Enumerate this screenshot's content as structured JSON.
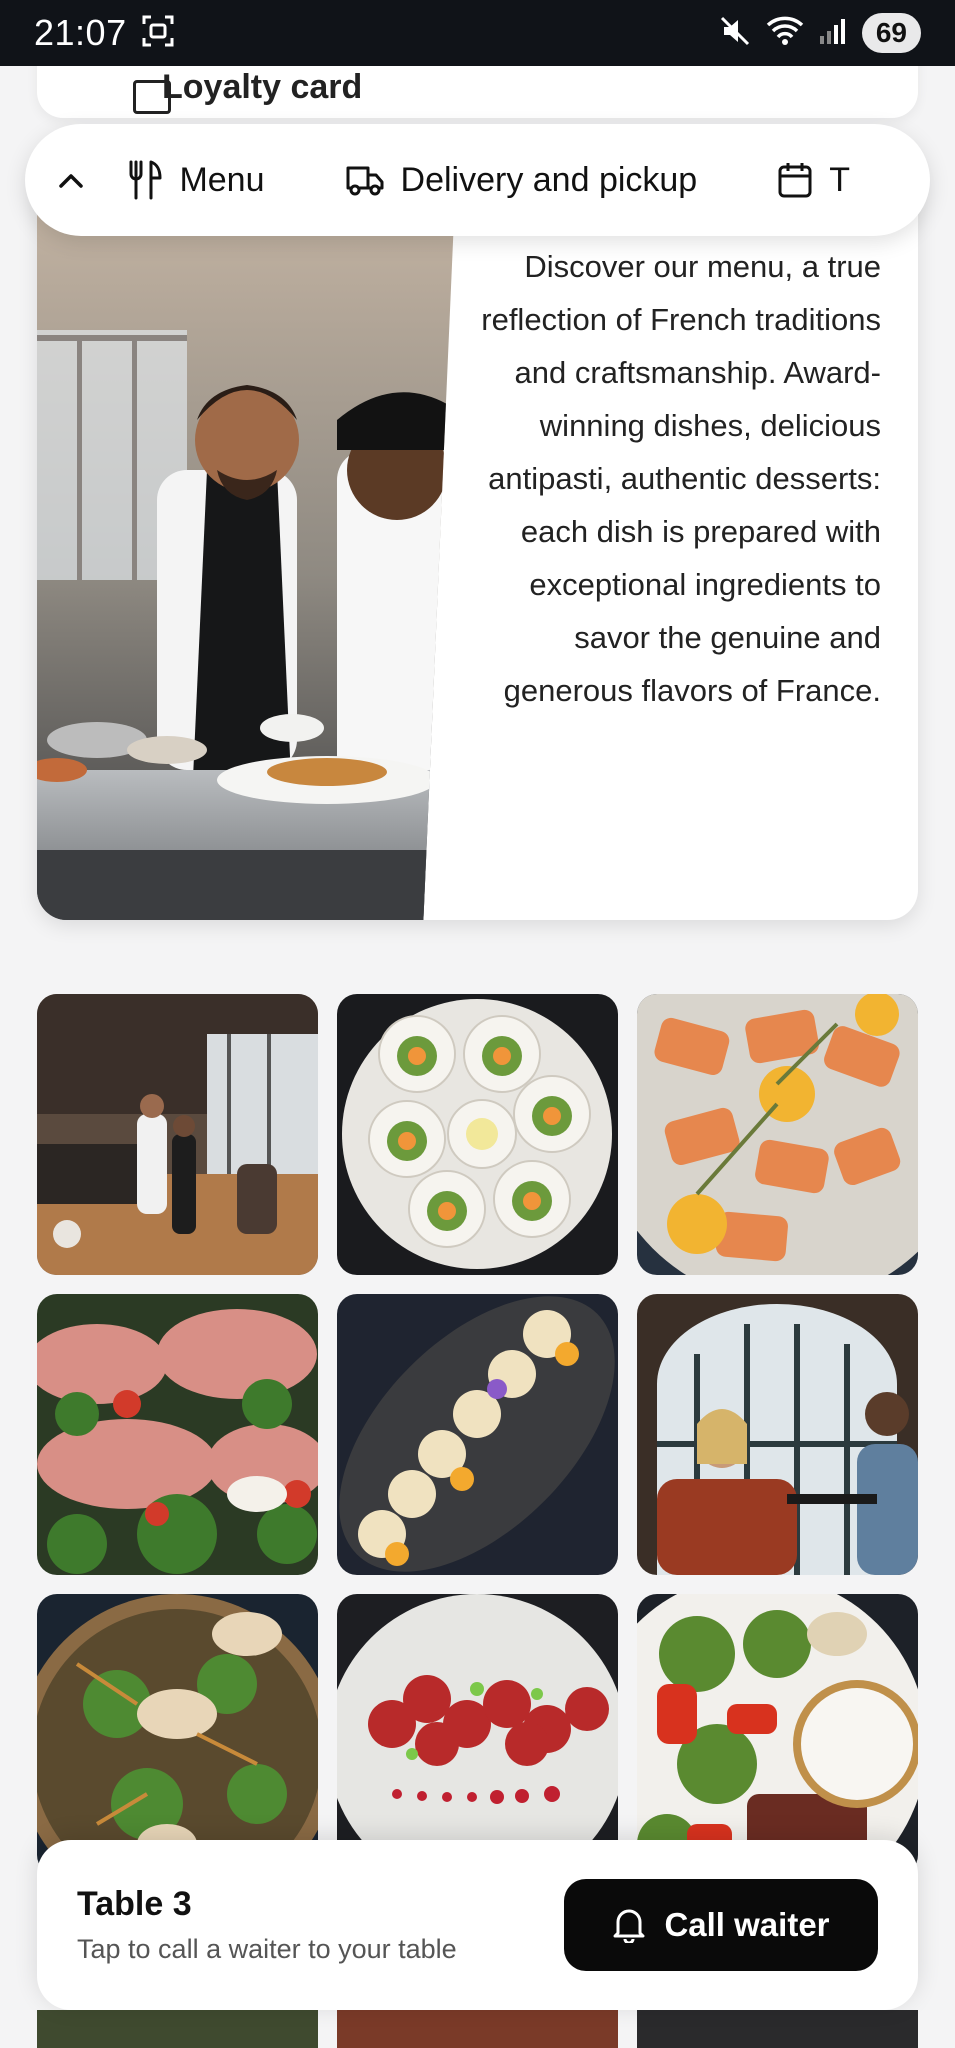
{
  "status_bar": {
    "time": "21:07",
    "battery": "69"
  },
  "loyalty_card": {
    "label": "Loyalty card"
  },
  "nav": {
    "items": [
      {
        "label": "Menu",
        "icon": "utensils-icon"
      },
      {
        "label": "Delivery and pickup",
        "icon": "truck-icon"
      },
      {
        "label": "T",
        "icon": "calendar-icon"
      }
    ]
  },
  "intro": {
    "text": "Discover our menu, a true reflection of French traditions and craftsmanship. Award-winning dishes, delicious antipasti, authentic desserts: each dish is prepared with exceptional ingredients to savor the genuine and generous flavors of France."
  },
  "gallery": {
    "photos": [
      "restaurant-interior",
      "scallops-plate",
      "salmon-citrus",
      "prosciutto-rolls",
      "crostini-slate",
      "couple-dining",
      "salad-bowl",
      "red-bites-plate",
      "steak-salad-dip"
    ]
  },
  "waiter": {
    "title": "Table 3",
    "subtitle": "Tap to call a waiter to your table",
    "button_label": "Call waiter"
  },
  "colors": {
    "status_bar_bg": "#101318",
    "button_bg": "#0a0a0a",
    "page_bg": "#f4f4f5"
  }
}
